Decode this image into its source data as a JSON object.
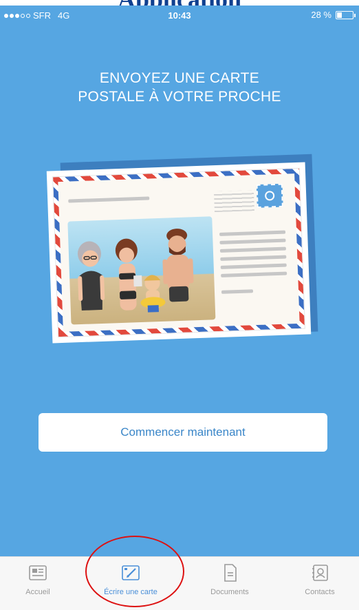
{
  "clipped_heading": "Application",
  "status_bar": {
    "carrier": "SFR",
    "network": "4G",
    "time": "10:43",
    "battery": "28 %",
    "battery_level": 0.28
  },
  "headline": {
    "line1": "ENVOYEZ UNE CARTE",
    "line2": "POSTALE À VOTRE PROCHE"
  },
  "cta": {
    "label": "Commencer maintenant"
  },
  "tabs": [
    {
      "label": "Accueil",
      "icon": "newspaper-icon",
      "active": false
    },
    {
      "label": "Écrire une carte",
      "icon": "write-card-icon",
      "active": true
    },
    {
      "label": "Documents",
      "icon": "document-icon",
      "active": false
    },
    {
      "label": "Contacts",
      "icon": "contacts-icon",
      "active": false
    }
  ],
  "colors": {
    "background": "#56a6e2",
    "accent": "#4a8fd8",
    "annotation": "#dd1111"
  }
}
